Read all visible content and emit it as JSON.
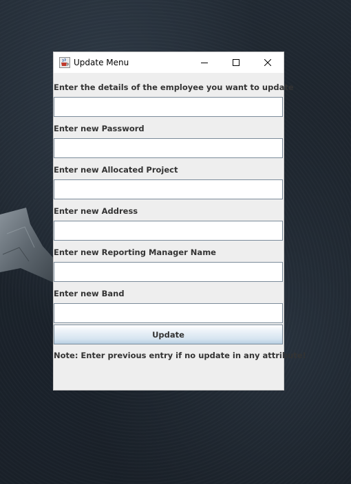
{
  "window": {
    "title": "Update Menu",
    "icon": "java-coffee-cup-icon",
    "controls": [
      "minimize-icon",
      "maximize-icon",
      "close-icon"
    ]
  },
  "form": {
    "fields": [
      {
        "label": "Enter the details of the employee you want to update",
        "value": ""
      },
      {
        "label": "Enter new Password",
        "value": ""
      },
      {
        "label": "Enter new Allocated Project",
        "value": ""
      },
      {
        "label": "Enter new Address",
        "value": ""
      },
      {
        "label": "Enter new Reporting Manager Name",
        "value": ""
      },
      {
        "label": "Enter new Band",
        "value": ""
      }
    ],
    "submit_label": "Update",
    "note": "Note: Enter previous entry if no update in any attribute!"
  },
  "colors": {
    "window_bg": "#eeeeee",
    "text": "#333333",
    "field_border": "#7a8a99",
    "desktop": "#1e262f"
  }
}
